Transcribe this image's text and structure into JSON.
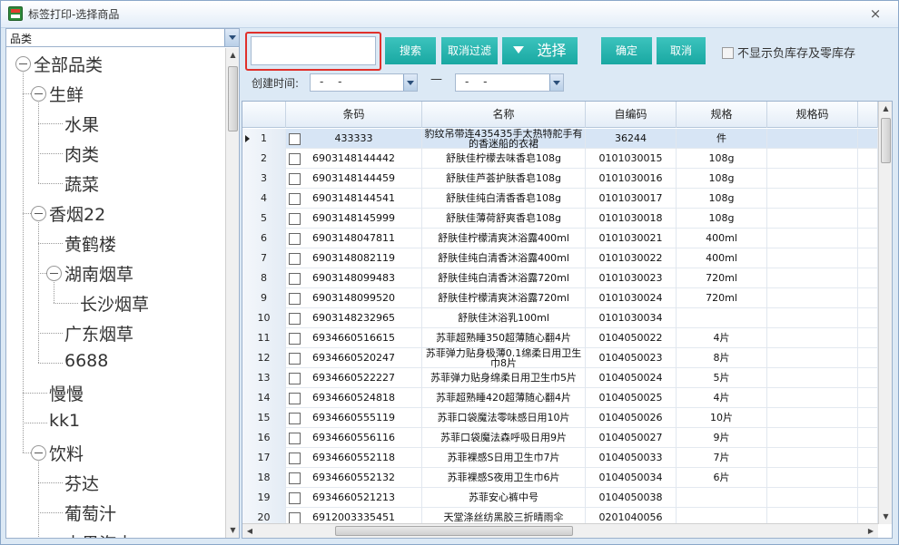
{
  "window": {
    "title": "标签打印-选择商品",
    "close": "×"
  },
  "left": {
    "category_select": "品类",
    "tree": [
      {
        "label": "全部品类",
        "level": 0
      },
      {
        "label": "生鲜",
        "level": 1
      },
      {
        "label": "水果",
        "level": 2
      },
      {
        "label": "肉类",
        "level": 2
      },
      {
        "label": "蔬菜",
        "level": 2
      },
      {
        "label": "香烟22",
        "level": 1
      },
      {
        "label": "黄鹤楼",
        "level": 2
      },
      {
        "label": "湖南烟草",
        "level": 2
      },
      {
        "label": "长沙烟草",
        "level": 3
      },
      {
        "label": "广东烟草",
        "level": 2
      },
      {
        "label": "6688",
        "level": 2
      },
      {
        "label": "慢慢",
        "level": 1
      },
      {
        "label": "kk1",
        "level": 1
      },
      {
        "label": "饮料",
        "level": 1
      },
      {
        "label": "芬达",
        "level": 2
      },
      {
        "label": "葡萄汁",
        "level": 2
      },
      {
        "label": "水果汽水",
        "level": 2
      }
    ]
  },
  "toolbar": {
    "search_value": "",
    "search_btn": "搜索",
    "cancel_filter_btn": "取消过滤",
    "select_btn": "选择",
    "confirm_btn": "确定",
    "cancel_btn": "取消",
    "hide_negative_label": "不显示负库存及零库存",
    "create_time_label": "创建时间:",
    "date_from": "-  -",
    "date_to": "-  -",
    "range_sep": "—"
  },
  "grid": {
    "columns": [
      "",
      "条码",
      "名称",
      "自编码",
      "规格",
      "规格码"
    ],
    "rows": [
      [
        "1",
        "433333",
        "豹纹吊带连435435手太热特舵手有的香迷船的衣裙",
        "36244",
        "件"
      ],
      [
        "2",
        "6903148144442",
        "舒肤佳柠檬去味香皂108g",
        "0101030015",
        "108g"
      ],
      [
        "3",
        "6903148144459",
        "舒肤佳芦荟护肤香皂108g",
        "0101030016",
        "108g"
      ],
      [
        "4",
        "6903148144541",
        "舒肤佳纯白清香香皂108g",
        "0101030017",
        "108g"
      ],
      [
        "5",
        "6903148145999",
        "舒肤佳薄荷舒爽香皂108g",
        "0101030018",
        "108g"
      ],
      [
        "6",
        "6903148047811",
        "舒肤佳柠檬清爽沐浴露400ml",
        "0101030021",
        "400ml"
      ],
      [
        "7",
        "6903148082119",
        "舒肤佳纯白清香沐浴露400ml",
        "0101030022",
        "400ml"
      ],
      [
        "8",
        "6903148099483",
        "舒肤佳纯白清香沐浴露720ml",
        "0101030023",
        "720ml"
      ],
      [
        "9",
        "6903148099520",
        "舒肤佳柠檬清爽沐浴露720ml",
        "0101030024",
        "720ml"
      ],
      [
        "10",
        "6903148232965",
        "舒肤佳沐浴乳100ml",
        "0101030034",
        ""
      ],
      [
        "11",
        "6934660516615",
        "苏菲超熟睡350超薄随心翻4片",
        "0104050022",
        "4片"
      ],
      [
        "12",
        "6934660520247",
        "苏菲弹力贴身极薄0.1绵柔日用卫生巾8片",
        "0104050023",
        "8片"
      ],
      [
        "13",
        "6934660522227",
        "苏菲弹力贴身绵柔日用卫生巾5片",
        "0104050024",
        "5片"
      ],
      [
        "14",
        "6934660524818",
        "苏菲超熟睡420超薄随心翻4片",
        "0104050025",
        "4片"
      ],
      [
        "15",
        "6934660555119",
        "苏菲口袋魔法零味感日用10片",
        "0104050026",
        "10片"
      ],
      [
        "16",
        "6934660556116",
        "苏菲口袋魔法森呼吸日用9片",
        "0104050027",
        "9片"
      ],
      [
        "17",
        "6934660552118",
        "苏菲裸感S日用卫生巾7片",
        "0104050033",
        "7片"
      ],
      [
        "18",
        "6934660552132",
        "苏菲裸感S夜用卫生巾6片",
        "0104050034",
        "6片"
      ],
      [
        "19",
        "6934660521213",
        "苏菲安心裤中号",
        "0104050038",
        ""
      ],
      [
        "20",
        "6912003335451",
        "天堂涤丝纺黑胶三折晴雨伞",
        "0201040056",
        ""
      ]
    ]
  },
  "colors": {
    "accent": "#1fb0aa",
    "highlight": "#e0302b",
    "selected_row": "#d7e5f5"
  }
}
